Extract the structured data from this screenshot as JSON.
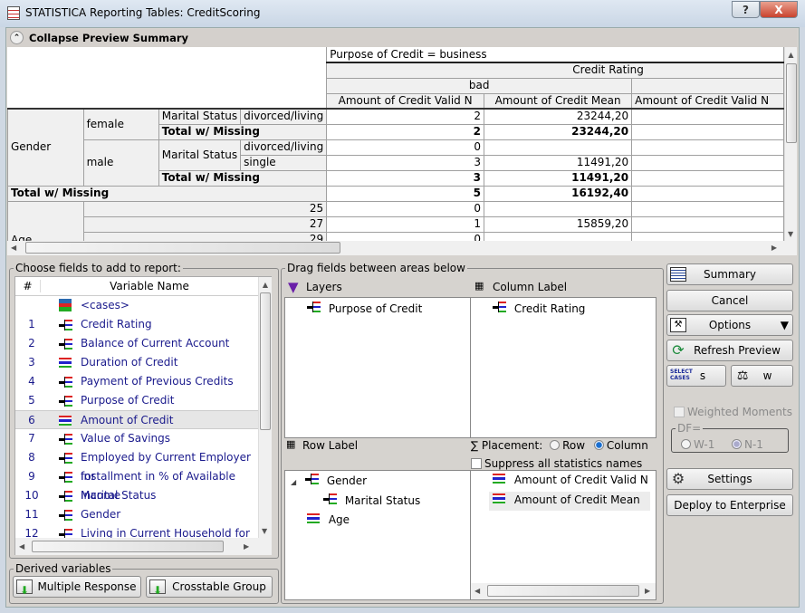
{
  "window": {
    "title": "STATISTICA Reporting Tables: CreditScoring",
    "help": "?",
    "close": "X"
  },
  "collapse": {
    "label": "Collapse Preview Summary"
  },
  "table": {
    "layer": "Purpose of Credit = business",
    "column_var": "Credit Rating",
    "column_level": "bad",
    "col_headers": [
      "Amount of Credit Valid N",
      "Amount of Credit Mean",
      "Amount of Credit Valid N"
    ],
    "gender": "Gender",
    "female": "female",
    "male": "male",
    "marital": "Marital Status",
    "divorced": "divorced/living",
    "single": "single",
    "total": "Total w/ Missing",
    "age": "Age",
    "rows": [
      {
        "n": "2",
        "mean": "23244,20"
      },
      {
        "n": "2",
        "mean": "23244,20"
      },
      {
        "n": "0",
        "mean": ""
      },
      {
        "n": "3",
        "mean": "11491,20"
      },
      {
        "n": "3",
        "mean": "11491,20"
      },
      {
        "n": "5",
        "mean": "16192,40"
      },
      {
        "label": "25",
        "n": "0",
        "mean": ""
      },
      {
        "label": "27",
        "n": "1",
        "mean": "15859,20"
      },
      {
        "label": "29",
        "n": "0",
        "mean": ""
      }
    ]
  },
  "fields": {
    "legend": "Choose fields to add to report:",
    "col_num": "#",
    "col_name": "Variable Name",
    "items": [
      {
        "num": "",
        "name": "<cases>",
        "icon": "cases-icon"
      },
      {
        "num": "1",
        "name": "Credit Rating",
        "icon": "categorical-icon"
      },
      {
        "num": "2",
        "name": "Balance of Current Account",
        "icon": "categorical-icon"
      },
      {
        "num": "3",
        "name": "Duration of Credit",
        "icon": "continuous-icon"
      },
      {
        "num": "4",
        "name": "Payment of Previous Credits",
        "icon": "categorical-icon"
      },
      {
        "num": "5",
        "name": "Purpose of Credit",
        "icon": "categorical-icon"
      },
      {
        "num": "6",
        "name": "Amount of Credit",
        "icon": "continuous-icon",
        "selected": true
      },
      {
        "num": "7",
        "name": "Value of Savings",
        "icon": "categorical-icon"
      },
      {
        "num": "8",
        "name": "Employed by Current Employer for",
        "icon": "categorical-icon"
      },
      {
        "num": "9",
        "name": "Installment in % of Available Income",
        "icon": "categorical-icon"
      },
      {
        "num": "10",
        "name": "Marital Status",
        "icon": "categorical-icon"
      },
      {
        "num": "11",
        "name": "Gender",
        "icon": "categorical-icon"
      },
      {
        "num": "12",
        "name": "Living in Current Household for",
        "icon": "categorical-icon"
      }
    ]
  },
  "derived": {
    "legend": "Derived variables",
    "multiple": "Multiple Response",
    "crosstable": "Crosstable Group"
  },
  "drag": {
    "legend": "Drag fields between areas below",
    "layers": "Layers",
    "layers_items": [
      "Purpose of Credit"
    ],
    "column_label": "Column Label",
    "column_items": [
      "Credit Rating"
    ],
    "row_label": "Row Label",
    "row_items": [
      "Gender",
      "Marital Status",
      "Age"
    ],
    "placement": "Placement:",
    "placement_row": "Row",
    "placement_column": "Column",
    "placement_selected": "Column",
    "suppress": "Suppress all statistics names",
    "stats_items": [
      "Amount of Credit Valid N",
      "Amount of Credit Mean"
    ]
  },
  "buttons": {
    "summary": "Summary",
    "cancel": "Cancel",
    "options": "Options",
    "refresh": "Refresh Preview",
    "select_cases": "s",
    "weights": "w",
    "weighted": "Weighted Moments",
    "df": "DF=",
    "w1": "W-1",
    "n1": "N-1",
    "settings": "Settings",
    "deploy": "Deploy to Enterprise"
  }
}
